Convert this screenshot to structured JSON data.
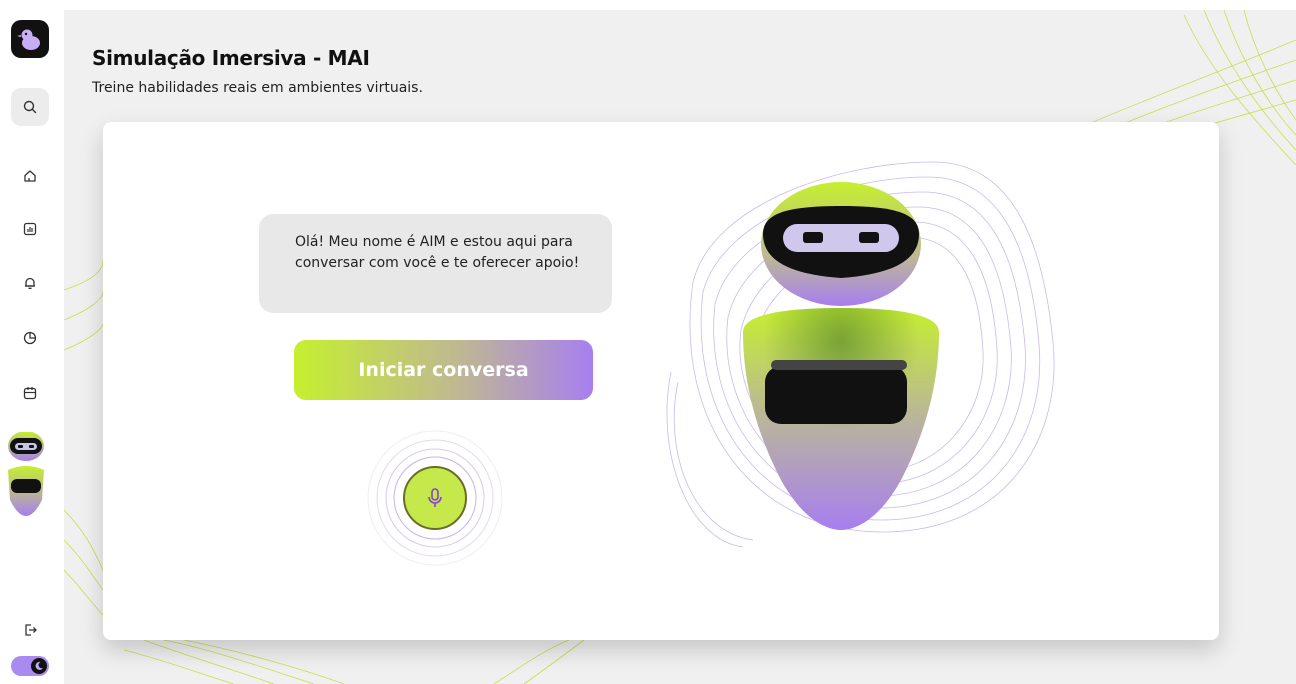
{
  "sidebar": {
    "items": [
      {
        "icon": "home-icon"
      },
      {
        "icon": "bar-chart-icon"
      },
      {
        "icon": "bell-icon"
      },
      {
        "icon": "pie-chart-icon"
      },
      {
        "icon": "calendar-icon"
      }
    ],
    "logout_icon": "logout-icon",
    "theme_toggle_icon": "moon-icon"
  },
  "header": {
    "title": "Simulação Imersiva - MAI",
    "subtitle": "Treine habilidades reais em ambientes virtuais."
  },
  "chat": {
    "bubble_text": "Olá! Meu nome é AIM e estou aqui para conversar com você e te oferecer apoio!",
    "start_label": "Iniciar conversa"
  },
  "colors": {
    "accent_green": "#c6ef2e",
    "accent_purple": "#a77ff0",
    "mic_bg": "#c5e84a"
  }
}
